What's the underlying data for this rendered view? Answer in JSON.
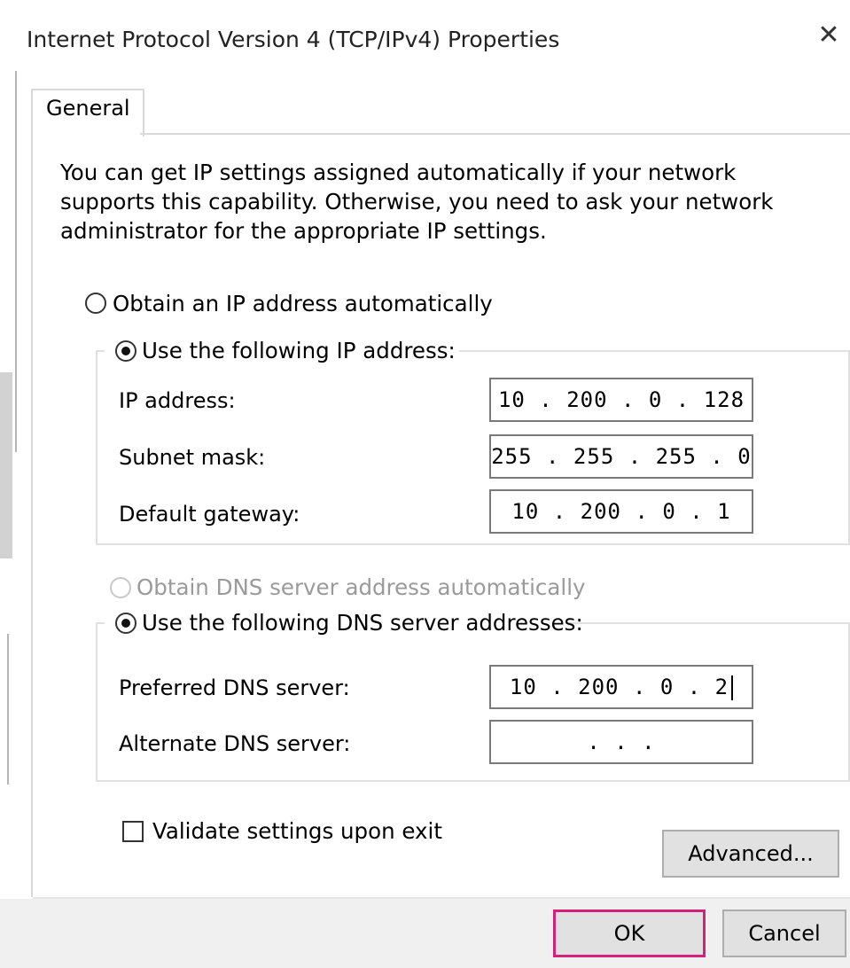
{
  "window": {
    "title": "Internet Protocol Version 4 (TCP/IPv4) Properties",
    "close_glyph": "✕"
  },
  "tabs": [
    {
      "label": "General"
    }
  ],
  "description": "You can get IP settings assigned automatically if your network supports this capability. Otherwise, you need to ask your network administrator for the appropriate IP settings.",
  "ip_mode": {
    "auto_label": "Obtain an IP address automatically",
    "manual_label": "Use the following IP address:",
    "selected": "manual"
  },
  "ip_fields": {
    "ip_label": "IP address:",
    "ip_value": "10 . 200 . 0 . 128",
    "mask_label": "Subnet mask:",
    "mask_value": "255 . 255 . 255 . 0",
    "gateway_label": "Default gateway:",
    "gateway_value": "10 . 200 . 0 . 1"
  },
  "dns_mode": {
    "auto_label": "Obtain DNS server address automatically",
    "manual_label": "Use the following DNS server addresses:",
    "selected": "manual"
  },
  "dns_fields": {
    "preferred_label": "Preferred DNS server:",
    "preferred_value": "10 . 200 . 0 . 2",
    "alternate_label": "Alternate DNS server:",
    "alternate_value": ".       .       ."
  },
  "validate": {
    "label": "Validate settings upon exit",
    "checked": false
  },
  "buttons": {
    "advanced": "Advanced...",
    "ok": "OK",
    "cancel": "Cancel"
  },
  "colors": {
    "focus_border": "#d6217c",
    "button_face": "#e1e1e1",
    "disabled_text": "#9a9a9a"
  }
}
